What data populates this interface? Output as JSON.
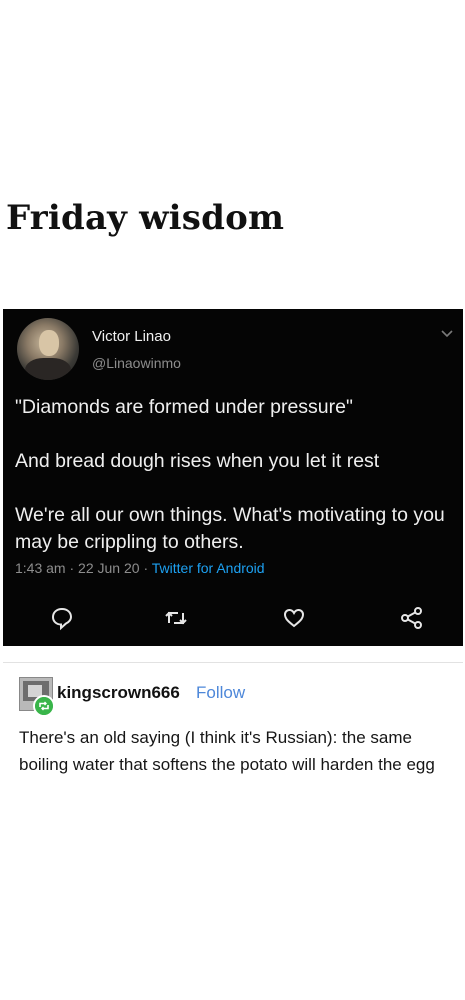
{
  "title": "Friday wisdom",
  "tweet": {
    "name": "Victor Linao",
    "handle": "@Linaowinmo",
    "line1": "\"Diamonds are formed under pressure\"",
    "line2": "And bread dough rises when you let it rest",
    "line3": "We're all our own things. What's motivating to you may be crippling to others.",
    "time": "1:43 am",
    "date": "22 Jun 20",
    "source": "Twitter for Android",
    "sep": "·",
    "icons": [
      "reply-icon",
      "retweet-icon",
      "like-icon",
      "share-icon",
      "chevron-down-icon"
    ]
  },
  "post": {
    "username": "kingscrown666",
    "follow_label": "Follow",
    "text": "There's an old saying (I think it's Russian): the same boiling water that softens the potato will harden the egg",
    "accent": "#4d87d9",
    "badge_color": "#39b54a"
  }
}
